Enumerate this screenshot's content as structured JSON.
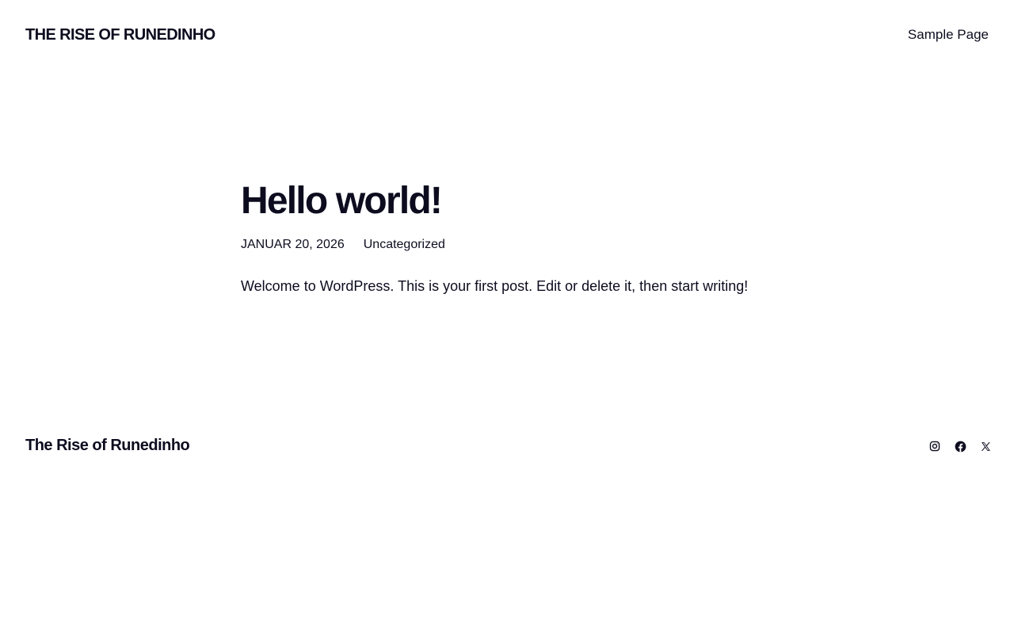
{
  "header": {
    "site_title": "THE RISE OF RUNEDINHO",
    "nav": [
      {
        "label": "Sample Page"
      }
    ]
  },
  "post": {
    "title": "Hello world!",
    "date": "JANUAR 20, 2026",
    "category": "Uncategorized",
    "excerpt": "Welcome to WordPress. This is your first post. Edit or delete it, then start writing!"
  },
  "footer": {
    "site_title": "The Rise of Runedinho",
    "social": [
      {
        "icon": "instagram-icon"
      },
      {
        "icon": "facebook-icon"
      },
      {
        "icon": "x-icon"
      }
    ]
  },
  "colors": {
    "text": "#0d0c1f",
    "background": "#ffffff"
  }
}
